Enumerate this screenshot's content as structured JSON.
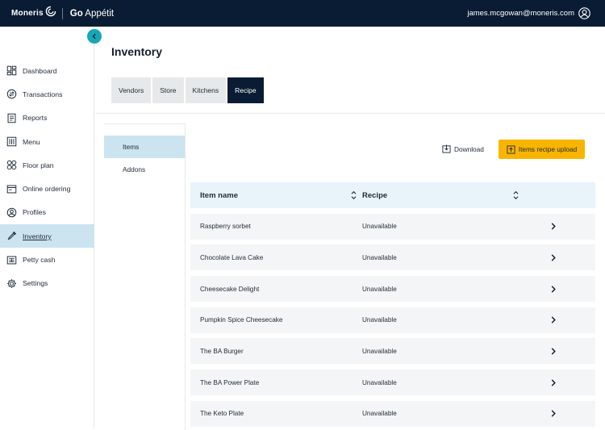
{
  "brand": {
    "name": "Moneris",
    "product_prefix": "Go",
    "product_name": "Appétit"
  },
  "user": {
    "email": "james.mcgowan@moneris.com"
  },
  "sidebar": {
    "items": [
      {
        "label": "Dashboard",
        "icon": "dashboard-icon"
      },
      {
        "label": "Transactions",
        "icon": "transactions-icon"
      },
      {
        "label": "Reports",
        "icon": "reports-icon"
      },
      {
        "label": "Menu",
        "icon": "menu-icon"
      },
      {
        "label": "Floor plan",
        "icon": "floor-plan-icon"
      },
      {
        "label": "Online ordering",
        "icon": "online-ordering-icon"
      },
      {
        "label": "Profiles",
        "icon": "profiles-icon"
      },
      {
        "label": "Inventory",
        "icon": "inventory-icon",
        "active": true
      },
      {
        "label": "Petty cash",
        "icon": "petty-cash-icon"
      },
      {
        "label": "Settings",
        "icon": "settings-icon"
      }
    ]
  },
  "page": {
    "title": "Inventory"
  },
  "tabs": [
    {
      "label": "Vendors"
    },
    {
      "label": "Store"
    },
    {
      "label": "Kitchens"
    },
    {
      "label": "Recipe",
      "active": true
    }
  ],
  "subnav": [
    {
      "label": "Items",
      "active": true
    },
    {
      "label": "Addons"
    }
  ],
  "actions": {
    "download": "Download",
    "upload": "Items recipe upload"
  },
  "table": {
    "columns": [
      "Item name",
      "Recipe"
    ],
    "rows": [
      {
        "name": "Raspberry sorbet",
        "recipe": "Unavailable"
      },
      {
        "name": "Chocolate Lava Cake",
        "recipe": "Unavailable"
      },
      {
        "name": "Cheesecake Delight",
        "recipe": "Unavailable"
      },
      {
        "name": "Pumpkin Spice Cheesecake",
        "recipe": "Unavailable"
      },
      {
        "name": "The BA Burger",
        "recipe": "Unavailable"
      },
      {
        "name": "The BA Power Plate",
        "recipe": "Unavailable"
      },
      {
        "name": "The Keto Plate",
        "recipe": "Unavailable"
      }
    ]
  },
  "colors": {
    "topbar": "#0a1c33",
    "accent": "#17a6b6",
    "active_nav": "#cbe4ef",
    "upload_button": "#f8b500"
  }
}
